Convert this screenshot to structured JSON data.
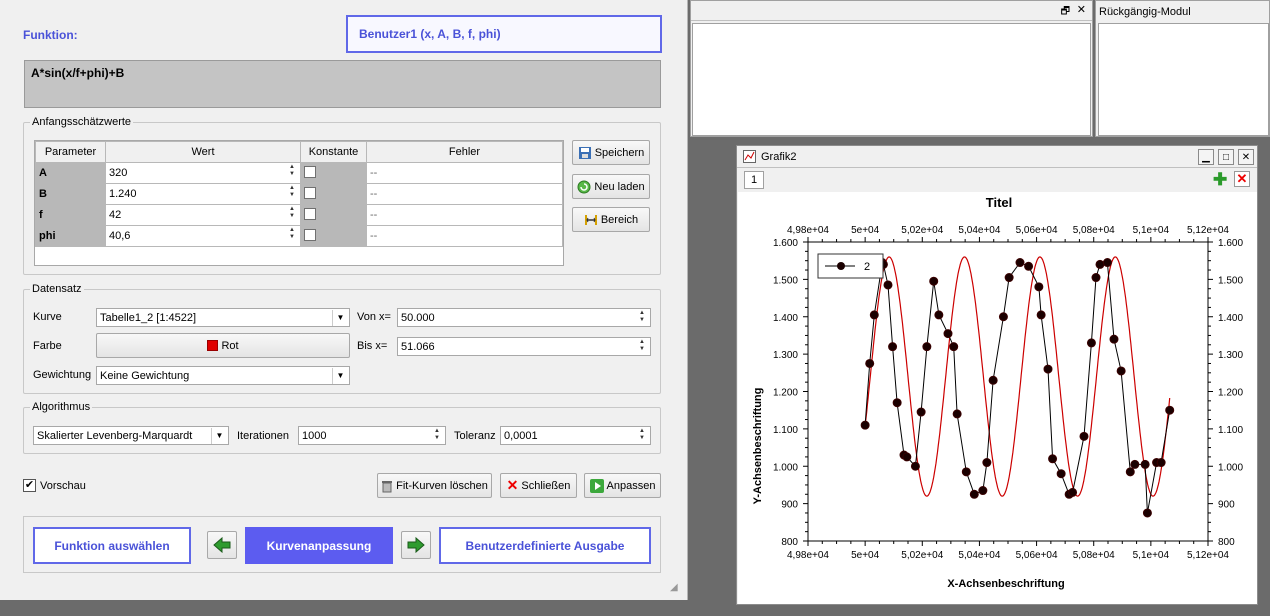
{
  "header": {
    "function_label": "Funktion:",
    "function_name": "Benutzer1 (x, A, B, f, phi)"
  },
  "formula": "A*sin(x/f+phi)+B",
  "initial_values": {
    "title": "Anfangsschätzwerte",
    "columns": [
      "Parameter",
      "Wert",
      "Konstante",
      "Fehler"
    ],
    "rows": [
      {
        "param": "A",
        "value": "320",
        "error": "--"
      },
      {
        "param": "B",
        "value": "1.240",
        "error": "--"
      },
      {
        "param": "f",
        "value": "42",
        "error": "--"
      },
      {
        "param": "phi",
        "value": "40,6",
        "error": "--"
      }
    ],
    "buttons": {
      "save": "Speichern",
      "reload": "Neu laden",
      "range": "Bereich"
    }
  },
  "dataset": {
    "title": "Datensatz",
    "curve_label": "Kurve",
    "curve_value": "Tabelle1_2 [1:4522]",
    "from_label": "Von x=",
    "from_value": "50.000",
    "color_label": "Farbe",
    "color_value": "Rot",
    "color_swatch": "#e00000",
    "to_label": "Bis x=",
    "to_value": "51.066",
    "weight_label": "Gewichtung",
    "weight_value": "Keine Gewichtung"
  },
  "algorithm": {
    "title": "Algorithmus",
    "method": "Skalierter Levenberg-Marquardt",
    "iterations_label": "Iterationen",
    "iterations_value": "1000",
    "tolerance_label": "Toleranz",
    "tolerance_value": "0,0001"
  },
  "preview_label": "Vorschau",
  "actions": {
    "clear": "Fit-Kurven löschen",
    "close": "Schließen",
    "fit": "Anpassen"
  },
  "nav": {
    "select_function": "Funktion auswählen",
    "curve_fit": "Kurvenanpassung",
    "custom_output": "Benutzerdefinierte Ausgabe"
  },
  "undo_panel": {
    "title": "Rückgängig-Modul"
  },
  "graph_window": {
    "title": "Grafik2",
    "layer_tab": "1"
  },
  "colors": {
    "accent": "#4a52d8",
    "active_nav": "#5c5cf0",
    "fit_curve": "#cc0000",
    "points": "#1a0000"
  },
  "chart_data": {
    "type": "scatter",
    "title": "Titel",
    "xlabel": "X-Achsenbeschriftung",
    "ylabel": "Y-Achsenbeschriftung",
    "xlim": [
      49800,
      51200
    ],
    "ylim": [
      800,
      1600
    ],
    "x_ticks": [
      49800,
      50000,
      50200,
      50400,
      50600,
      50800,
      51000,
      51200
    ],
    "x_tick_labels": [
      "4,98e+04",
      "5e+04",
      "5,02e+04",
      "5,04e+04",
      "5,06e+04",
      "5,08e+04",
      "5,1e+04",
      "5,12e+04"
    ],
    "y_ticks": [
      800,
      900,
      1000,
      1100,
      1200,
      1300,
      1400,
      1500,
      1600
    ],
    "y_tick_labels_left": [
      "800",
      "900",
      "1.000",
      "1.100",
      "1.200",
      "1.300",
      "1.400",
      "1.500",
      "1.600"
    ],
    "y_tick_labels_right": [
      "800",
      "900",
      "1.000",
      "1.100",
      "1.200",
      "1.300",
      "1.400",
      "1.500",
      "1.600"
    ],
    "legend": {
      "entries": [
        "2"
      ],
      "position": "top-left"
    },
    "series": [
      {
        "name": "2",
        "x": [
          50000,
          50016,
          50032,
          50060,
          50064,
          50080,
          50096,
          50112,
          50136,
          50146,
          50176,
          50196,
          50216,
          50240,
          50258,
          50290,
          50310,
          50322,
          50354,
          50382,
          50412,
          50426,
          50448,
          50484,
          50504,
          50542,
          50572,
          50608,
          50616,
          50640,
          50656,
          50686,
          50714,
          50726,
          50766,
          50792,
          50808,
          50822,
          50848,
          50871,
          50896,
          50928,
          50944,
          50980,
          50988,
          51020,
          51036,
          51066
        ],
        "y": [
          1110,
          1275,
          1405,
          1545,
          1540,
          1485,
          1320,
          1170,
          1030,
          1025,
          1000,
          1145,
          1320,
          1495,
          1405,
          1355,
          1320,
          1140,
          985,
          925,
          935,
          1010,
          1230,
          1400,
          1505,
          1545,
          1535,
          1480,
          1405,
          1260,
          1020,
          980,
          925,
          930,
          1080,
          1330,
          1505,
          1540,
          1545,
          1340,
          1255,
          985,
          1005,
          1005,
          875,
          1010,
          1010,
          1150
        ]
      }
    ],
    "fit_curve": {
      "A": 320,
      "B": 1240,
      "f": 42,
      "phi": 40.6,
      "color": "#cc0000"
    }
  }
}
